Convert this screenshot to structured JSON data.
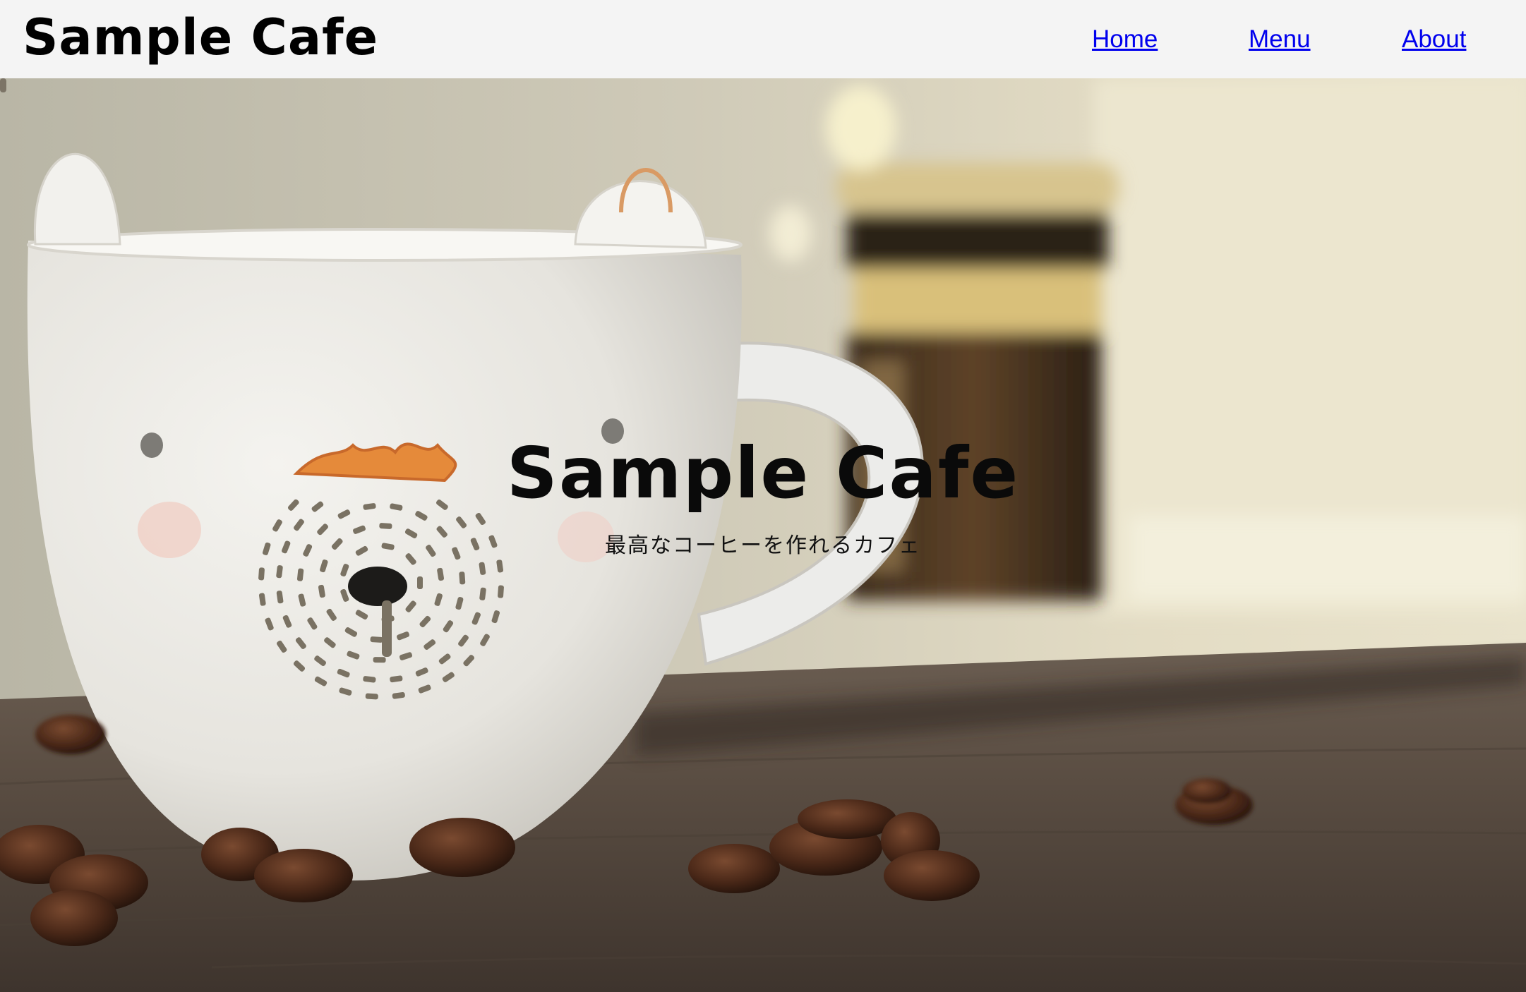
{
  "header": {
    "brand": "Sample Cafe",
    "nav": [
      {
        "label": "Home"
      },
      {
        "label": "Menu"
      },
      {
        "label": "About"
      }
    ]
  },
  "hero": {
    "title": "Sample Cafe",
    "subtitle": "最高なコーヒーを作れるカフェ",
    "background_image": "coffee-mug-with-bear-face-and-beans-icon"
  },
  "colors": {
    "header_bg": "#f4f4f4",
    "link": "#0000ee",
    "text": "#000000"
  }
}
